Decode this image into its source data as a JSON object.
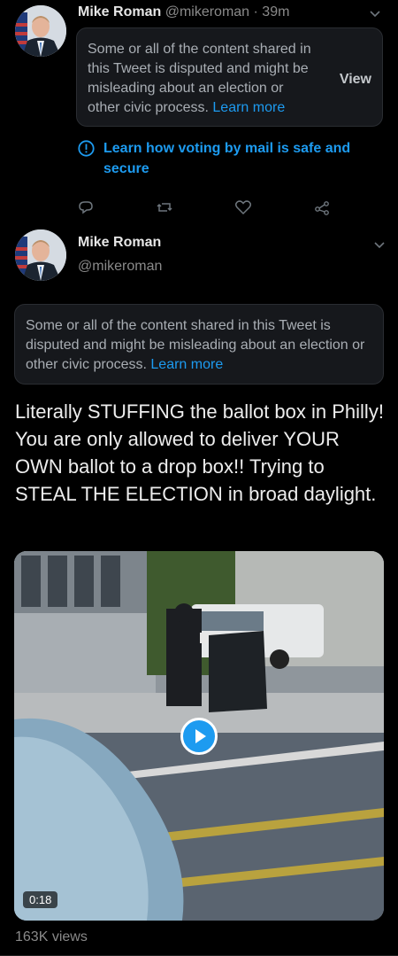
{
  "tweet1": {
    "author_name": "Mike Roman",
    "author_handle": "@mikeroman",
    "time": "· 39m",
    "notice_text": "Some or all of the content shared in this Tweet is disputed and might be misleading about an election or other civic process.",
    "notice_link": "Learn more",
    "view_label": "View",
    "voting_info_label": "Learn how voting by mail is safe and secure",
    "actions": [
      "reply-icon",
      "retweet-icon",
      "like-icon",
      "share-icon"
    ]
  },
  "tweet2": {
    "author_name": "Mike Roman",
    "author_handle": "@mikeroman",
    "notice_text": "Some or all of the content shared in this Tweet is disputed and might be misleading about an election or other civic process.",
    "notice_link": "Learn more",
    "body": "Literally STUFFING the ballot box in Philly!  You are only allowed to deliver YOUR OWN ballot to a drop box!! Trying to STEAL THE ELECTION in broad daylight.",
    "video_duration": "0:18",
    "views": "163K views"
  },
  "colors": {
    "background": "#000000",
    "link": "#1d9bf0",
    "notice_bg": "#16181c",
    "muted_text": "#8a8a8a"
  }
}
